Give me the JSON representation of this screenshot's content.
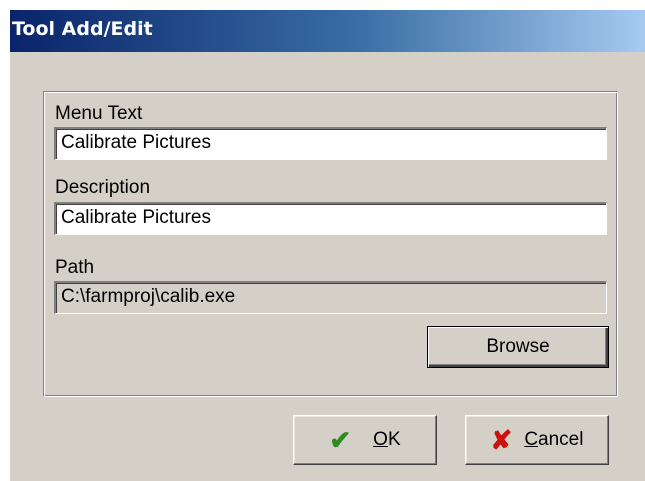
{
  "window": {
    "title": "Tool Add/Edit"
  },
  "form": {
    "menu_text": {
      "label": "Menu Text",
      "value": "Calibrate Pictures"
    },
    "description": {
      "label": "Description",
      "value": "Calibrate Pictures"
    },
    "path": {
      "label": "Path",
      "value": "C:\\farmproj\\calib.exe"
    }
  },
  "buttons": {
    "browse": "Browse",
    "ok": "OK",
    "cancel": "Cancel"
  },
  "icons": {
    "ok": "checkmark-icon",
    "cancel": "x-icon"
  },
  "colors": {
    "titlebar_start": "#0a246a",
    "titlebar_end": "#a6caf0",
    "face": "#d4d0c8",
    "ok_icon": "#2e8b1f",
    "cancel_icon": "#cc1111"
  }
}
